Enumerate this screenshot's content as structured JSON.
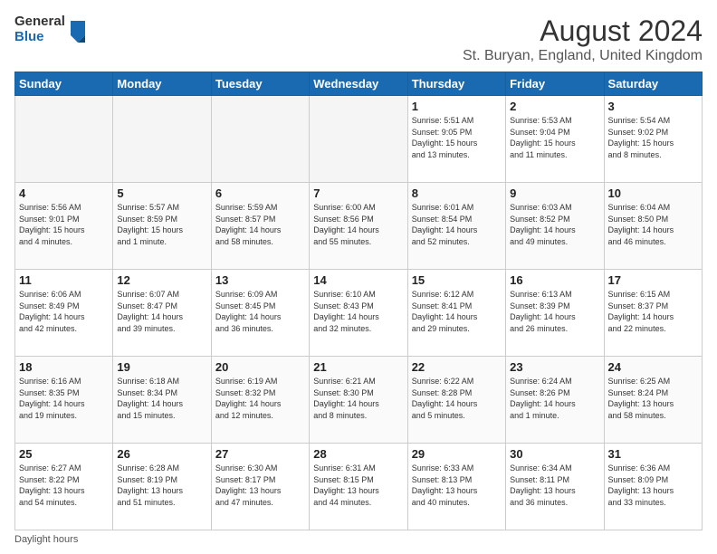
{
  "logo": {
    "general": "General",
    "blue": "Blue"
  },
  "title": "August 2024",
  "subtitle": "St. Buryan, England, United Kingdom",
  "days_of_week": [
    "Sunday",
    "Monday",
    "Tuesday",
    "Wednesday",
    "Thursday",
    "Friday",
    "Saturday"
  ],
  "weeks": [
    [
      {
        "day": "",
        "info": ""
      },
      {
        "day": "",
        "info": ""
      },
      {
        "day": "",
        "info": ""
      },
      {
        "day": "",
        "info": ""
      },
      {
        "day": "1",
        "info": "Sunrise: 5:51 AM\nSunset: 9:05 PM\nDaylight: 15 hours\nand 13 minutes."
      },
      {
        "day": "2",
        "info": "Sunrise: 5:53 AM\nSunset: 9:04 PM\nDaylight: 15 hours\nand 11 minutes."
      },
      {
        "day": "3",
        "info": "Sunrise: 5:54 AM\nSunset: 9:02 PM\nDaylight: 15 hours\nand 8 minutes."
      }
    ],
    [
      {
        "day": "4",
        "info": "Sunrise: 5:56 AM\nSunset: 9:01 PM\nDaylight: 15 hours\nand 4 minutes."
      },
      {
        "day": "5",
        "info": "Sunrise: 5:57 AM\nSunset: 8:59 PM\nDaylight: 15 hours\nand 1 minute."
      },
      {
        "day": "6",
        "info": "Sunrise: 5:59 AM\nSunset: 8:57 PM\nDaylight: 14 hours\nand 58 minutes."
      },
      {
        "day": "7",
        "info": "Sunrise: 6:00 AM\nSunset: 8:56 PM\nDaylight: 14 hours\nand 55 minutes."
      },
      {
        "day": "8",
        "info": "Sunrise: 6:01 AM\nSunset: 8:54 PM\nDaylight: 14 hours\nand 52 minutes."
      },
      {
        "day": "9",
        "info": "Sunrise: 6:03 AM\nSunset: 8:52 PM\nDaylight: 14 hours\nand 49 minutes."
      },
      {
        "day": "10",
        "info": "Sunrise: 6:04 AM\nSunset: 8:50 PM\nDaylight: 14 hours\nand 46 minutes."
      }
    ],
    [
      {
        "day": "11",
        "info": "Sunrise: 6:06 AM\nSunset: 8:49 PM\nDaylight: 14 hours\nand 42 minutes."
      },
      {
        "day": "12",
        "info": "Sunrise: 6:07 AM\nSunset: 8:47 PM\nDaylight: 14 hours\nand 39 minutes."
      },
      {
        "day": "13",
        "info": "Sunrise: 6:09 AM\nSunset: 8:45 PM\nDaylight: 14 hours\nand 36 minutes."
      },
      {
        "day": "14",
        "info": "Sunrise: 6:10 AM\nSunset: 8:43 PM\nDaylight: 14 hours\nand 32 minutes."
      },
      {
        "day": "15",
        "info": "Sunrise: 6:12 AM\nSunset: 8:41 PM\nDaylight: 14 hours\nand 29 minutes."
      },
      {
        "day": "16",
        "info": "Sunrise: 6:13 AM\nSunset: 8:39 PM\nDaylight: 14 hours\nand 26 minutes."
      },
      {
        "day": "17",
        "info": "Sunrise: 6:15 AM\nSunset: 8:37 PM\nDaylight: 14 hours\nand 22 minutes."
      }
    ],
    [
      {
        "day": "18",
        "info": "Sunrise: 6:16 AM\nSunset: 8:35 PM\nDaylight: 14 hours\nand 19 minutes."
      },
      {
        "day": "19",
        "info": "Sunrise: 6:18 AM\nSunset: 8:34 PM\nDaylight: 14 hours\nand 15 minutes."
      },
      {
        "day": "20",
        "info": "Sunrise: 6:19 AM\nSunset: 8:32 PM\nDaylight: 14 hours\nand 12 minutes."
      },
      {
        "day": "21",
        "info": "Sunrise: 6:21 AM\nSunset: 8:30 PM\nDaylight: 14 hours\nand 8 minutes."
      },
      {
        "day": "22",
        "info": "Sunrise: 6:22 AM\nSunset: 8:28 PM\nDaylight: 14 hours\nand 5 minutes."
      },
      {
        "day": "23",
        "info": "Sunrise: 6:24 AM\nSunset: 8:26 PM\nDaylight: 14 hours\nand 1 minute."
      },
      {
        "day": "24",
        "info": "Sunrise: 6:25 AM\nSunset: 8:24 PM\nDaylight: 13 hours\nand 58 minutes."
      }
    ],
    [
      {
        "day": "25",
        "info": "Sunrise: 6:27 AM\nSunset: 8:22 PM\nDaylight: 13 hours\nand 54 minutes."
      },
      {
        "day": "26",
        "info": "Sunrise: 6:28 AM\nSunset: 8:19 PM\nDaylight: 13 hours\nand 51 minutes."
      },
      {
        "day": "27",
        "info": "Sunrise: 6:30 AM\nSunset: 8:17 PM\nDaylight: 13 hours\nand 47 minutes."
      },
      {
        "day": "28",
        "info": "Sunrise: 6:31 AM\nSunset: 8:15 PM\nDaylight: 13 hours\nand 44 minutes."
      },
      {
        "day": "29",
        "info": "Sunrise: 6:33 AM\nSunset: 8:13 PM\nDaylight: 13 hours\nand 40 minutes."
      },
      {
        "day": "30",
        "info": "Sunrise: 6:34 AM\nSunset: 8:11 PM\nDaylight: 13 hours\nand 36 minutes."
      },
      {
        "day": "31",
        "info": "Sunrise: 6:36 AM\nSunset: 8:09 PM\nDaylight: 13 hours\nand 33 minutes."
      }
    ]
  ],
  "footer": "Daylight hours"
}
